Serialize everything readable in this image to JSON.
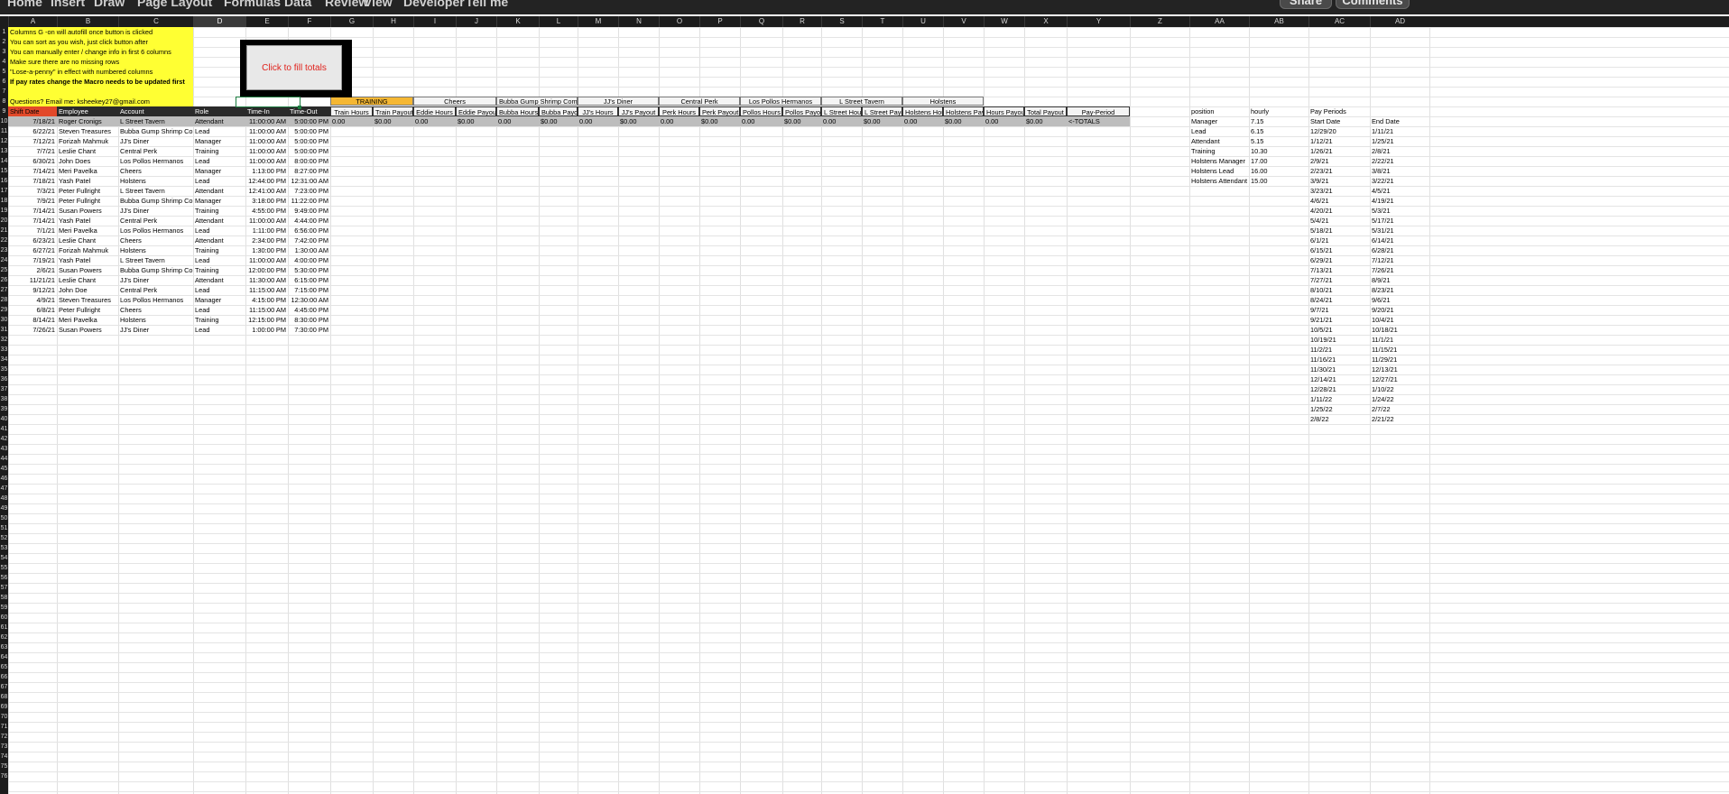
{
  "toolbar": {
    "menu": [
      "Home",
      "Insert",
      "Draw",
      "Page Layout",
      "Formulas",
      "Data",
      "Review",
      "View",
      "Developer",
      "Tell me"
    ],
    "share_label": "Share",
    "comments_label": "Comments"
  },
  "columns": [
    "A",
    "B",
    "C",
    "D",
    "E",
    "F",
    "G",
    "H",
    "I",
    "J",
    "K",
    "L",
    "M",
    "N",
    "O",
    "P",
    "Q",
    "R",
    "S",
    "T",
    "U",
    "V",
    "W",
    "X",
    "Y",
    "Z",
    "AA",
    "AB",
    "AC",
    "AD"
  ],
  "selected_column": "D",
  "selected_cell": "D8",
  "row_numbers": [
    "1",
    "2",
    "3",
    "4",
    "5",
    "6",
    "7",
    "8",
    "9",
    "10",
    "11",
    "12",
    "13",
    "14",
    "15",
    "16",
    "17",
    "18",
    "19",
    "20",
    "21",
    "22",
    "23",
    "24",
    "25",
    "26",
    "27",
    "28",
    "29",
    "30",
    "31",
    "32",
    "33",
    "34",
    "35",
    "36",
    "37",
    "38",
    "39",
    "40",
    "41",
    "42",
    "43",
    "44",
    "45",
    "46",
    "47",
    "48",
    "49",
    "50",
    "51",
    "52",
    "53",
    "54",
    "55",
    "56",
    "57",
    "58",
    "59",
    "60",
    "61",
    "62",
    "63",
    "64",
    "65",
    "66",
    "67",
    "68",
    "69",
    "70",
    "71",
    "72",
    "73",
    "74",
    "75",
    "76"
  ],
  "notes": [
    "Columns G -on will autofill once button is clicked",
    "You can sort as you wish, just click button after",
    "You can manually enter / change info in first 6 columns",
    "Make sure there are no missing rows",
    "\"Lose-a-penny\" in effect with numbered columns",
    "If pay rates change the Macro needs to be updated first",
    "",
    "Questions? Email me: ksheekey27@gmail.com"
  ],
  "macro_button_label": "Click to fill totals",
  "group_headers": [
    "TRAINING",
    "Cheers",
    "Bubba Gump Shrimp Company",
    "JJ's Diner",
    "Central Perk",
    "Los Pollos Hermanos",
    "L Street Tavern",
    "Holstens"
  ],
  "main_headers": [
    "Shift Date",
    "Employee",
    "Account",
    "Role",
    "Time-In",
    "Time-Out"
  ],
  "payout_headers": [
    "Train Hours",
    "Train Payout",
    "Eddie Hours",
    "Eddie Payout",
    "Bubba Hours",
    "Bubba Payout",
    "JJ's Hours",
    "JJ's Payout",
    "Perk Hours",
    "Perk Payout",
    "Pollos Hours",
    "Pollos Payout",
    "L Street Hours",
    "L Street Payout",
    "Holstens Hours",
    "Holstens Payout",
    "Hours Payout",
    "Total Payout",
    "Pay-Period"
  ],
  "totals_row": [
    "0.00",
    "$0.00",
    "0.00",
    "$0.00",
    "0.00",
    "$0.00",
    "0.00",
    "$0.00",
    "0.00",
    "$0.00",
    "0.00",
    "$0.00",
    "0.00",
    "$0.00",
    "0.00",
    "$0.00",
    "0.00",
    "$0.00",
    "<-TOTALS"
  ],
  "shifts": [
    [
      "7/18/21",
      "Roger Cronigs",
      "L Street Tavern",
      "Attendant",
      "11:00:00 AM",
      "5:00:00 PM"
    ],
    [
      "6/22/21",
      "Steven Treasures",
      "Bubba Gump Shrimp Company",
      "Lead",
      "11:00:00 AM",
      "5:00:00 PM"
    ],
    [
      "7/12/21",
      "Forizah Mahmuk",
      "JJ's Diner",
      "Manager",
      "11:00:00 AM",
      "5:00:00 PM"
    ],
    [
      "7/7/21",
      "Leslie Chant",
      "Central Perk",
      "Training",
      "11:00:00 AM",
      "5:00:00 PM"
    ],
    [
      "6/30/21",
      "John Does",
      "Los Pollos Hermanos",
      "Lead",
      "11:00:00 AM",
      "8:00:00 PM"
    ],
    [
      "7/14/21",
      "Meri Pavelka",
      "Cheers",
      "Manager",
      "1:13:00 PM",
      "8:27:00 PM"
    ],
    [
      "7/18/21",
      "Yash Patel",
      "Holstens",
      "Lead",
      "12:44:00 PM",
      "12:31:00 AM"
    ],
    [
      "7/3/21",
      "Peter Fullright",
      "L Street Tavern",
      "Attendant",
      "12:41:00 AM",
      "7:23:00 PM"
    ],
    [
      "7/9/21",
      "Peter Fullright",
      "Bubba Gump Shrimp Company",
      "Manager",
      "3:18:00 PM",
      "11:22:00 PM"
    ],
    [
      "7/14/21",
      "Susan Powers",
      "JJ's Diner",
      "Training",
      "4:55:00 PM",
      "9:49:00 PM"
    ],
    [
      "7/14/21",
      "Yash Patel",
      "Central Perk",
      "Attendant",
      "11:00:00 AM",
      "4:44:00 PM"
    ],
    [
      "7/1/21",
      "Meri Pavelka",
      "Los Pollos Hermanos",
      "Lead",
      "1:11:00 PM",
      "6:56:00 PM"
    ],
    [
      "6/23/21",
      "Leslie Chant",
      "Cheers",
      "Attendant",
      "2:34:00 PM",
      "7:42:00 PM"
    ],
    [
      "6/27/21",
      "Forizah Mahmuk",
      "Holstens",
      "Training",
      "1:30:00 PM",
      "1:30:00 AM"
    ],
    [
      "7/19/21",
      "Yash Patel",
      "L Street Tavern",
      "Lead",
      "11:00:00 AM",
      "4:00:00 PM"
    ],
    [
      "2/6/21",
      "Susan Powers",
      "Bubba Gump Shrimp Company",
      "Training",
      "12:00:00 PM",
      "5:30:00 PM"
    ],
    [
      "11/21/21",
      "Leslie Chant",
      "JJ's Diner",
      "Attendant",
      "11:30:00 AM",
      "6:15:00 PM"
    ],
    [
      "9/12/21",
      "John Doe",
      "Central Perk",
      "Lead",
      "11:15:00 AM",
      "7:15:00 PM"
    ],
    [
      "4/9/21",
      "Steven Treasures",
      "Los Pollos Hermanos",
      "Manager",
      "4:15:00 PM",
      "12:30:00 AM"
    ],
    [
      "6/8/21",
      "Peter Fullright",
      "Cheers",
      "Lead",
      "11:15:00 AM",
      "4:45:00 PM"
    ],
    [
      "8/14/21",
      "Meri Pavelka",
      "Holstens",
      "Training",
      "12:15:00 PM",
      "8:30:00 PM"
    ],
    [
      "7/26/21",
      "Susan Powers",
      "JJ's Diner",
      "Lead",
      "1:00:00 PM",
      "7:30:00 PM"
    ]
  ],
  "rates_header": [
    "position",
    "hourly"
  ],
  "rates": [
    [
      "Manager",
      "7.15"
    ],
    [
      "Lead",
      "6.15"
    ],
    [
      "Attendant",
      "5.15"
    ],
    [
      "Training",
      "10.30"
    ],
    [
      "Holstens Manager",
      "17.00"
    ],
    [
      "Holstens Lead",
      "16.00"
    ],
    [
      "Holstens Attendant",
      "15.00"
    ]
  ],
  "pay_periods_title": "Pay Periods",
  "pay_period_headers": [
    "Start Date",
    "End Date"
  ],
  "pay_periods": [
    [
      "12/29/20",
      "1/11/21"
    ],
    [
      "1/12/21",
      "1/25/21"
    ],
    [
      "1/26/21",
      "2/8/21"
    ],
    [
      "2/9/21",
      "2/22/21"
    ],
    [
      "2/23/21",
      "3/8/21"
    ],
    [
      "3/9/21",
      "3/22/21"
    ],
    [
      "3/23/21",
      "4/5/21"
    ],
    [
      "4/6/21",
      "4/19/21"
    ],
    [
      "4/20/21",
      "5/3/21"
    ],
    [
      "5/4/21",
      "5/17/21"
    ],
    [
      "5/18/21",
      "5/31/21"
    ],
    [
      "6/1/21",
      "6/14/21"
    ],
    [
      "6/15/21",
      "6/28/21"
    ],
    [
      "6/29/21",
      "7/12/21"
    ],
    [
      "7/13/21",
      "7/26/21"
    ],
    [
      "7/27/21",
      "8/9/21"
    ],
    [
      "8/10/21",
      "8/23/21"
    ],
    [
      "8/24/21",
      "9/6/21"
    ],
    [
      "9/7/21",
      "9/20/21"
    ],
    [
      "9/21/21",
      "10/4/21"
    ],
    [
      "10/5/21",
      "10/18/21"
    ],
    [
      "10/19/21",
      "11/1/21"
    ],
    [
      "11/2/21",
      "11/15/21"
    ],
    [
      "11/16/21",
      "11/29/21"
    ],
    [
      "11/30/21",
      "12/13/21"
    ],
    [
      "12/14/21",
      "12/27/21"
    ],
    [
      "12/28/21",
      "1/10/22"
    ],
    [
      "1/11/22",
      "1/24/22"
    ],
    [
      "1/25/22",
      "2/7/22"
    ],
    [
      "2/8/22",
      "2/21/22"
    ]
  ],
  "colors": {
    "note_yellow": "#ffff33",
    "training_orange": "#f5b733",
    "shift_date_red": "#e2492a",
    "totals_grey": "#bdbdbd",
    "macro_text_red": "#e0211b",
    "selection_green": "#1a7b3e"
  }
}
